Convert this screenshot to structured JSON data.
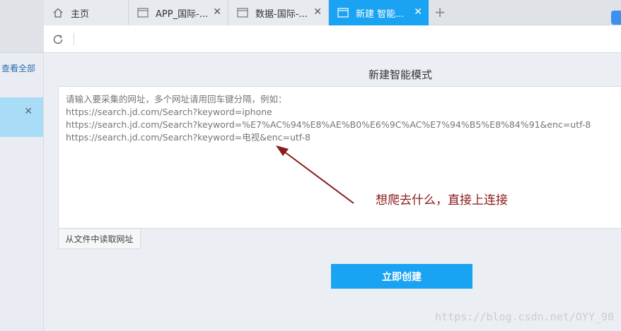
{
  "tabs": [
    {
      "label": "主页",
      "icon": "home-icon",
      "active": false,
      "closable": false
    },
    {
      "label": "APP_国际-...",
      "icon": "window-icon",
      "active": false,
      "closable": true
    },
    {
      "label": "数据-国际-...",
      "icon": "window-icon",
      "active": false,
      "closable": true
    },
    {
      "label": "新建 智能...",
      "icon": "window-icon",
      "active": true,
      "closable": true
    }
  ],
  "tab_add_label": "+",
  "tab_close_glyph": "✕",
  "sidebar": {
    "view_all_label": "查看全部",
    "close_glyph": "✕"
  },
  "page": {
    "title": "新建智能模式",
    "textarea_placeholder": "请输入要采集的网址，多个网址请用回车键分隔，例如：\nhttps://search.jd.com/Search?keyword=iphone\nhttps://search.jd.com/Search?keyword=%E7%AC%94%E8%AE%B0%E6%9C%AC%E7%94%B5%E8%84%91&enc=utf-8\nhttps://search.jd.com/Search?keyword=电视&enc=utf-8",
    "import_button_label": "从文件中读取网址",
    "create_button_label": "立即创建"
  },
  "annotation": {
    "text": "想爬去什么，直接上连接",
    "color": "#8b1a1a"
  },
  "watermark": "https://blog.csdn.net/OYY_90",
  "colors": {
    "accent": "#1aa3f2",
    "notice_bg": "#a9dcf6"
  }
}
